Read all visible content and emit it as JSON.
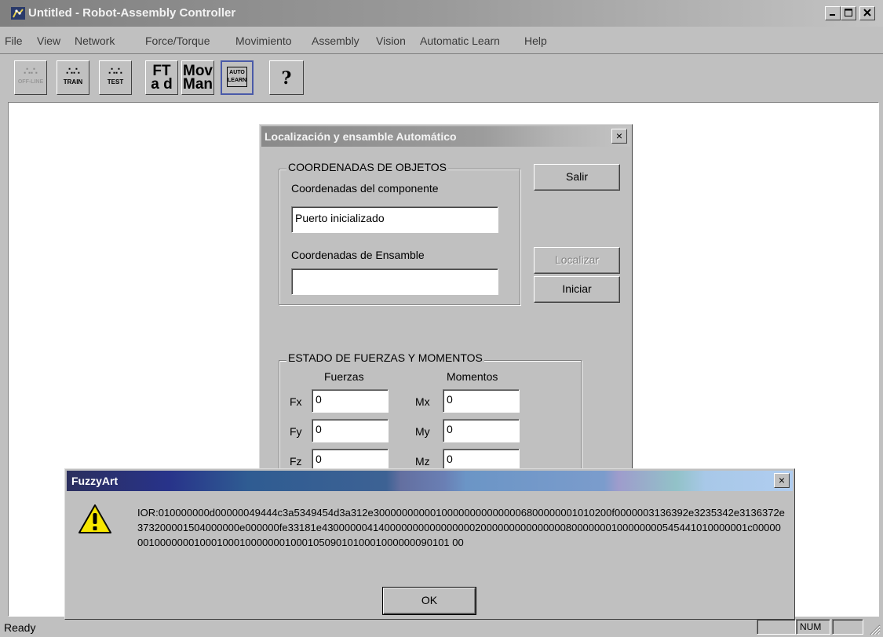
{
  "window": {
    "title": "Untitled - Robot-Assembly Controller"
  },
  "menu": [
    "File",
    "View",
    "Network",
    "Force/Torque",
    "Movimiento",
    "Assembly",
    "Vision",
    "Automatic Learn",
    "Help"
  ],
  "toolbar": {
    "off_line": "OFF-LINE",
    "train": "TRAIN",
    "test": "TEST",
    "ft_top": "FT",
    "ft_bottom": "a d",
    "mov_top": "Mov",
    "mov_bottom": "Man",
    "auto_top": "AUTO",
    "auto_bottom": "LEARN",
    "help_glyph": "?"
  },
  "status": {
    "text": "Ready",
    "num": "NUM"
  },
  "loc_dialog": {
    "title": "Localización y ensamble Automático",
    "close": "×",
    "group1": "COORDENADAS DE OBJETOS",
    "comp_label": "Coordenadas del componente",
    "comp_value": "Puerto inicializado",
    "ens_label": "Coordenadas de Ensamble",
    "ens_value": "",
    "salir": "Salir",
    "localizar": "Localizar",
    "iniciar": "Iniciar",
    "group2": "ESTADO DE FUERZAS Y MOMENTOS",
    "fuerzas": "Fuerzas",
    "momentos": "Momentos",
    "fx": "Fx",
    "fy": "Fy",
    "fz": "Fz",
    "mx": "Mx",
    "my": "My",
    "mz": "Mz",
    "fx_val": "0",
    "fy_val": "0",
    "fz_val": "0",
    "mx_val": "0",
    "my_val": "0",
    "mz_val": "0"
  },
  "msgbox": {
    "title": "FuzzyArt",
    "close": "×",
    "icon": "warning-icon",
    "message": "IOR:010000000d00000049444c3a5349454d3a312e300000000001000000000000006800000001010200f0000003136392e3235342e3136372e373200001504000000e000000fe33181e430000004140000000000000000200000000000000080000000100000000545441010000001c000000010000000100010001000000010001050901010001000000090101 00",
    "ok": "OK"
  }
}
